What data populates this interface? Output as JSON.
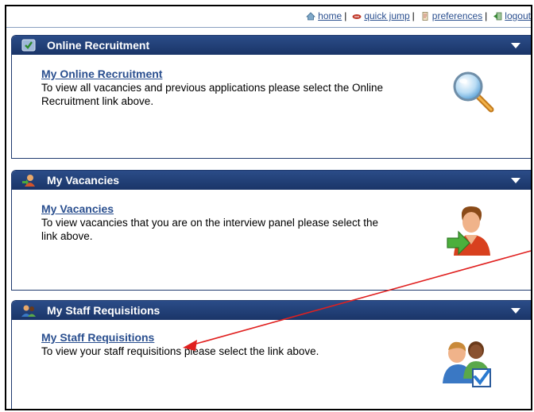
{
  "topnav": {
    "home": "home",
    "quick_jump": "quick jump",
    "preferences": "preferences",
    "logout": "logout",
    "separator": "|"
  },
  "panels": [
    {
      "title": "Online Recruitment",
      "link": "My Online Recruitment",
      "description": "To view all vacancies and previous applications please select the Online Recruitment link above.",
      "icon": "magnifier-icon"
    },
    {
      "title": "My Vacancies",
      "link": "My Vacancies",
      "description": "To view vacancies that you are on the interview panel please select the link above.",
      "icon": "user-arrow-icon"
    },
    {
      "title": "My Staff Requisitions",
      "link": "My Staff Requisitions",
      "description": "To view your staff requisitions please select the link above.",
      "icon": "users-check-icon"
    }
  ],
  "colors": {
    "header_bg": "#1d3c74",
    "link": "#2a4f8f",
    "annotation_arrow": "#e0201f"
  }
}
